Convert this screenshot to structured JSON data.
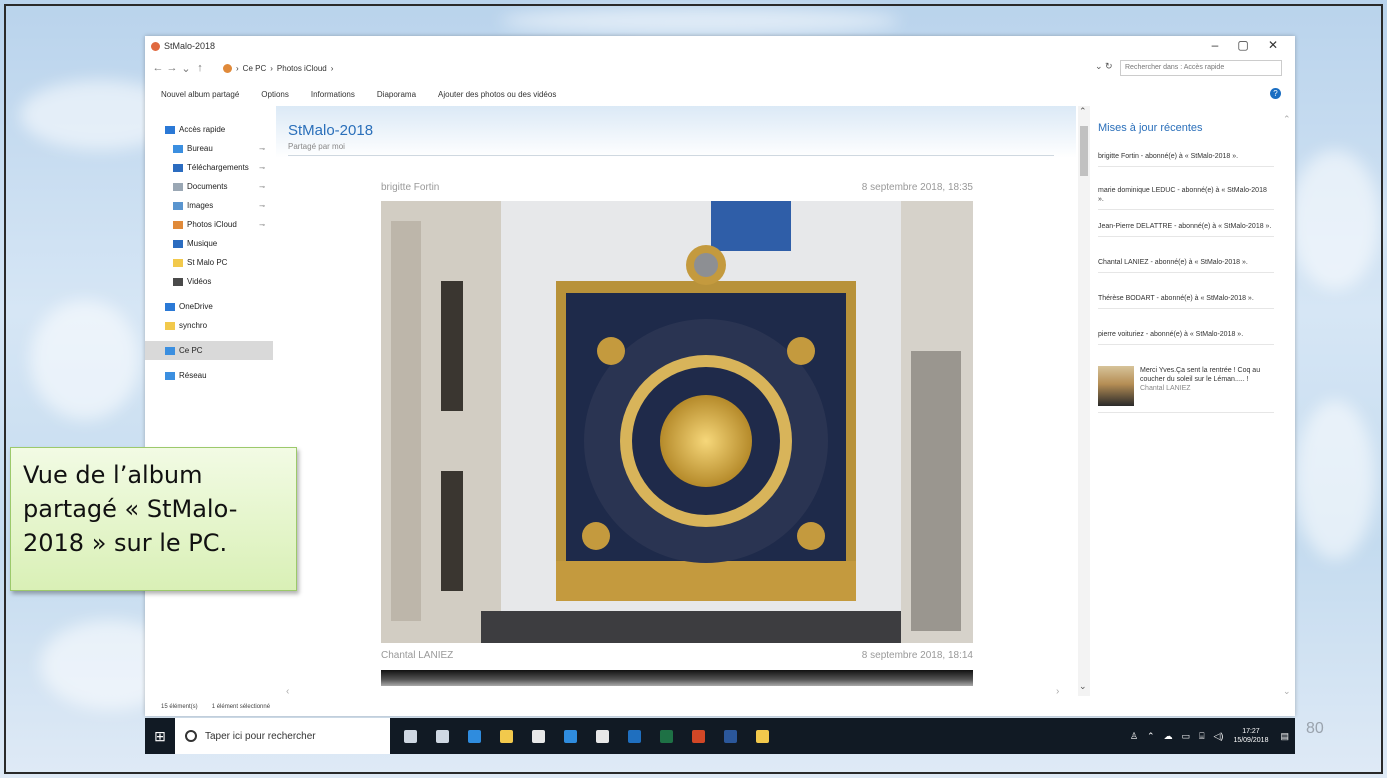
{
  "slide": {
    "number": "80"
  },
  "window": {
    "title": "StMalo-2018",
    "controls": {
      "minimize": "–",
      "maximize": "▢",
      "close": "✕"
    }
  },
  "addressbar": {
    "back": "←",
    "forward": "→",
    "recent": "⌄",
    "up": "↑",
    "path": [
      "Ce PC",
      "Photos iCloud"
    ],
    "separator": "›",
    "refresh": "⌄ ↻",
    "search_placeholder": "Rechercher dans : Accès rapide"
  },
  "toolbar": {
    "items": [
      "Nouvel album partagé",
      "Options",
      "Informations",
      "Diaporama",
      "Ajouter des photos ou des vidéos"
    ],
    "help": "?"
  },
  "sidebar": {
    "items": [
      {
        "label": "Accès rapide",
        "icon": "star-icon",
        "color": "#2b79d6"
      },
      {
        "label": "Bureau",
        "icon": "desktop-icon",
        "color": "#3b8fe0",
        "pinned": true
      },
      {
        "label": "Téléchargements",
        "icon": "download-icon",
        "color": "#2b6cc0",
        "pinned": true
      },
      {
        "label": "Documents",
        "icon": "document-icon",
        "color": "#9aa7b4",
        "pinned": true
      },
      {
        "label": "Images",
        "icon": "images-icon",
        "color": "#5a95cf",
        "pinned": true
      },
      {
        "label": "Photos iCloud",
        "icon": "icloud-photos-icon",
        "color": "#e08a3a",
        "pinned": true
      },
      {
        "label": "Musique",
        "icon": "music-icon",
        "color": "#2b6cc0"
      },
      {
        "label": "St Malo PC",
        "icon": "folder-icon",
        "color": "#f2c94c"
      },
      {
        "label": "Vidéos",
        "icon": "video-icon",
        "color": "#4a4a4a"
      },
      {
        "label": "OneDrive",
        "icon": "onedrive-icon",
        "color": "#2b79d6"
      },
      {
        "label": "synchro",
        "icon": "folder-icon",
        "color": "#f2c94c"
      },
      {
        "label": "Ce PC",
        "icon": "pc-icon",
        "color": "#3b8fe0",
        "selected": true
      },
      {
        "label": "Réseau",
        "icon": "network-icon",
        "color": "#3b8fe0"
      }
    ],
    "pin_glyph": "⊸"
  },
  "album": {
    "title": "StMalo-2018",
    "subtitle": "Partagé par moi",
    "posts": [
      {
        "author": "brigitte Fortin",
        "date": "8 septembre 2018, 18:35"
      },
      {
        "author": "Chantal LANIEZ",
        "date": "8 septembre 2018, 18:14"
      }
    ]
  },
  "recent_updates": {
    "title": "Mises à jour récentes",
    "items": [
      "brigitte Fortin - abonné(e) à « StMalo-2018 ».",
      "marie dominique LEDUC - abonné(e) à « StMalo-2018 ».",
      "Jean-Pierre DELATTRE - abonné(e) à « StMalo-2018 ».",
      "Chantal LANIEZ - abonné(e) à « StMalo-2018 ».",
      "Thérèse BODART - abonné(e) à « StMalo-2018 ».",
      "pierre voituriez - abonné(e) à « StMalo-2018 »."
    ],
    "comment": {
      "text": "Merci Yves.Ça sent la rentrée ! Coq au coucher du soleil sur le Léman..... !",
      "author": "Chantal LANIEZ"
    }
  },
  "statusbar": {
    "count": "15 élément(s)",
    "selection": "1 élément sélectionné"
  },
  "taskbar": {
    "search_placeholder": "Taper ici pour rechercher",
    "apps": [
      {
        "name": "microphone-icon",
        "color": "#cfd8e3"
      },
      {
        "name": "task-view-icon",
        "color": "#cfd8e3"
      },
      {
        "name": "edge-icon",
        "color": "#2f8cde"
      },
      {
        "name": "file-explorer-icon",
        "color": "#f2c94c"
      },
      {
        "name": "store-icon",
        "color": "#e8e8e8"
      },
      {
        "name": "cortana-app-icon",
        "color": "#2f8cde"
      },
      {
        "name": "mail-icon",
        "color": "#e8e8e8"
      },
      {
        "name": "outlook-icon",
        "color": "#1f6fbf"
      },
      {
        "name": "excel-icon",
        "color": "#1e7145"
      },
      {
        "name": "powerpoint-icon",
        "color": "#d24726"
      },
      {
        "name": "word-icon",
        "color": "#2b579a"
      },
      {
        "name": "paint-icon",
        "color": "#f2c94c"
      }
    ],
    "tray": {
      "time": "17:27",
      "date": "15/09/2018"
    }
  },
  "callout": {
    "lines": [
      "Vue de l’album",
      "partagé « StMalo-",
      "2018 » sur le PC."
    ]
  }
}
